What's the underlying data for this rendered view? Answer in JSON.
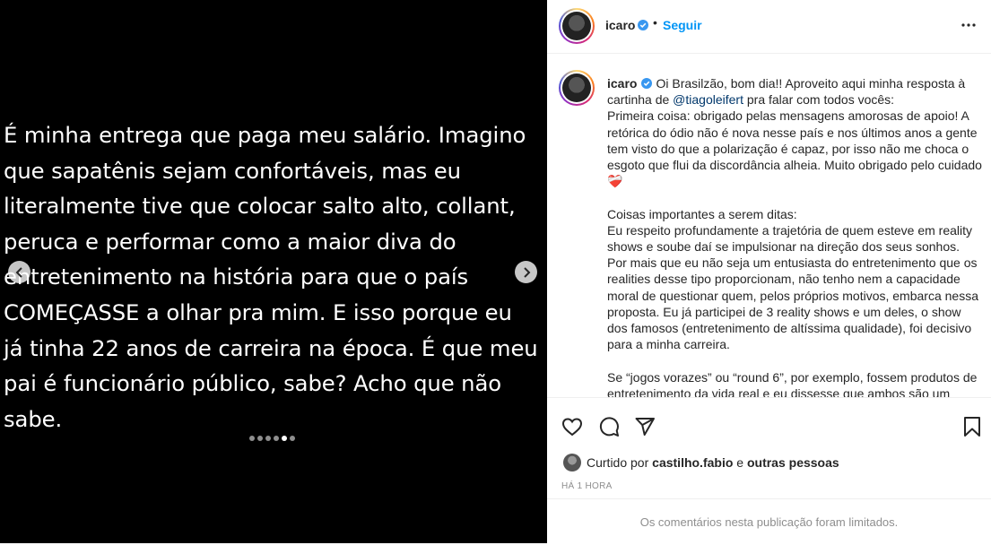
{
  "media": {
    "text": "É minha entrega que paga meu salário. Imagino\nque sapatênis sejam confortáveis, mas eu\nliteralmente tive que colocar salto alto, collant,\nperuca e performar como a maior diva do\nentretenimento na história para que o país\nCOMEÇASSE a olhar pra mim. E isso porque eu\njá tinha 22 anos de carreira na época. É que meu\npai é funcionário público, sabe? Acho que não\nsabe.",
    "slide_count": 6,
    "active_slide": 5
  },
  "header": {
    "username": "icaro",
    "separator": "•",
    "follow_label": "Seguir"
  },
  "caption": {
    "username": "icaro",
    "part1": "Oi Brasilzão, bom dia!! Aproveito aqui minha resposta à cartinha de ",
    "mention": "@tiagoleifert",
    "part2": " pra falar com todos vocês:\nPrimeira coisa: obrigado pelas mensagens amorosas de apoio! A retórica do ódio não é nova nesse país e nos últimos anos a gente tem visto do que a polarização é capaz, por isso não me choca o esgoto que flui da discordância alheia. Muito obrigado pelo cuidado❤️‍🩹\n\nCoisas importantes a serem ditas:\nEu respeito profundamente a trajetória de quem esteve em reality shows e soube daí se impulsionar na direção dos seus sonhos. Por mais que eu não seja um entusiasta do entretenimento que os realities desse tipo proporcionam, não tenho nem a capacidade moral de questionar quem, pelos próprios motivos, embarca nessa proposta. Eu já participei de 3 reality shows e um deles, o show dos famosos (entretenimento de altíssima qualidade), foi decisivo para a minha carreira.\n\nSe “jogos vorazes” ou “round 6”, por exemplo, fossem produtos de entretenimento da vida real e eu dissesse que ambos são um"
  },
  "likes": {
    "prefix": "Curtido por",
    "user": "castilho.fabio",
    "conj": "e",
    "others": "outras pessoas"
  },
  "time": "HÁ 1 HORA",
  "comments_limited": "Os comentários nesta publicação foram limitados.",
  "colors": {
    "accent": "#0095f6",
    "verified": "#3897f0",
    "text": "#262626",
    "muted": "#8e8e8e"
  }
}
